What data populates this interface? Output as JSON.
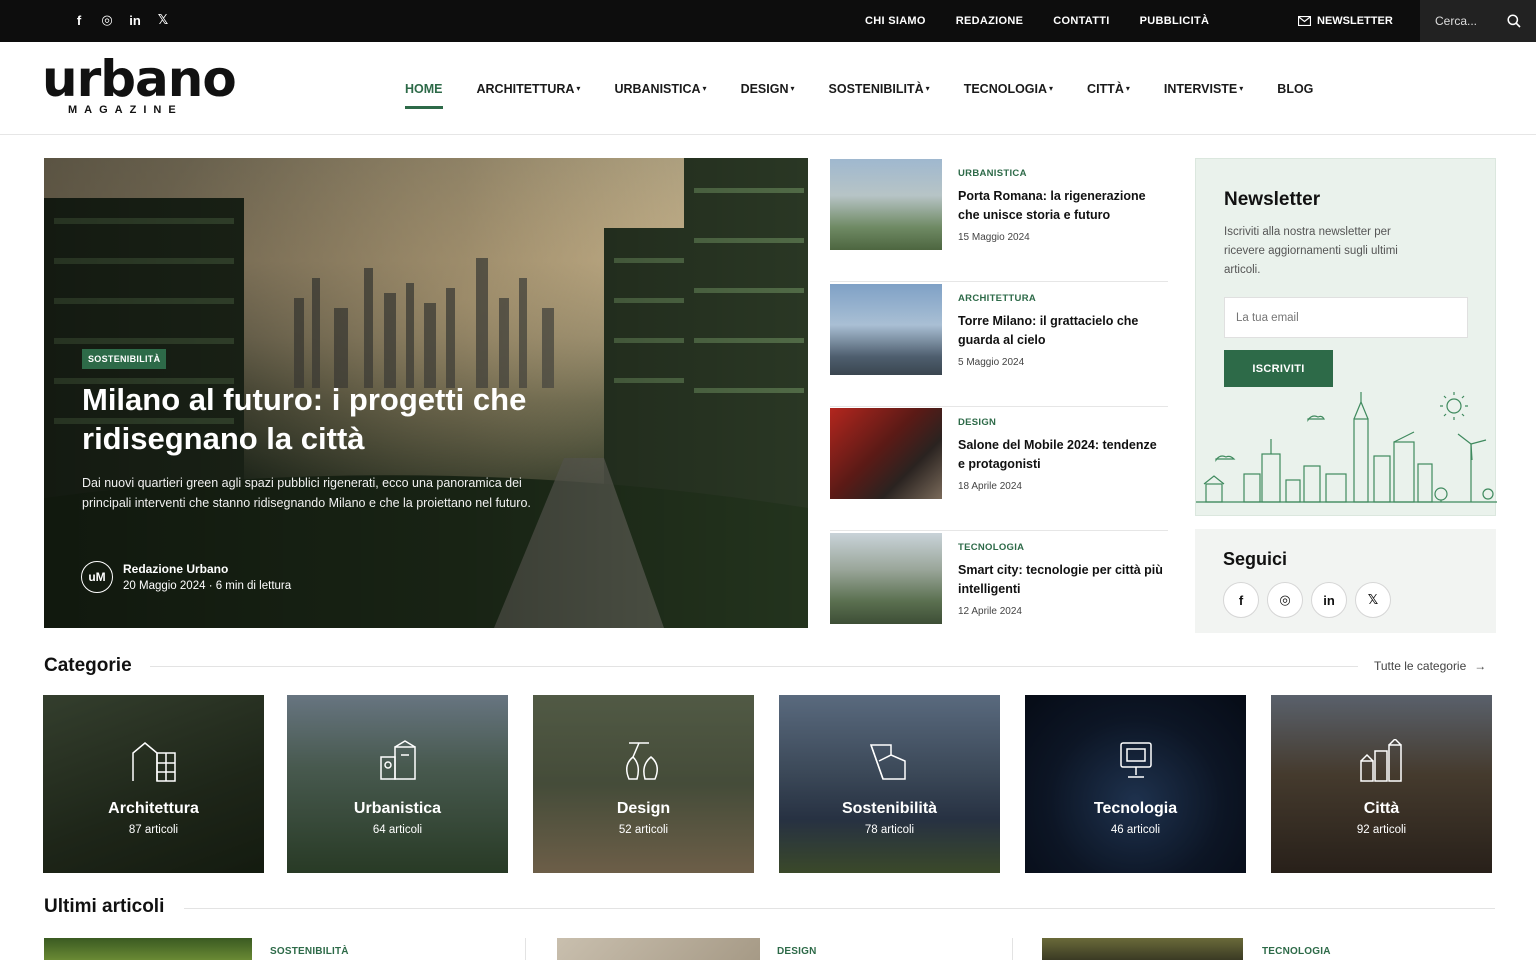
{
  "topbar": {
    "socials": [
      {
        "icon": "facebook-icon",
        "glyph": "f"
      },
      {
        "icon": "instagram-icon",
        "glyph": "◎"
      },
      {
        "icon": "linkedin-icon",
        "glyph": "in"
      },
      {
        "icon": "x-icon",
        "glyph": "𝕏"
      }
    ],
    "links": [
      "CHI SIAMO",
      "REDAZIONE",
      "CONTATTI",
      "PUBBLICITÀ"
    ],
    "newsletter": "NEWSLETTER",
    "search_placeholder": "Cerca..."
  },
  "header": {
    "logo_word": "urbano",
    "logo_sub": "MAGAZINE",
    "nav": [
      {
        "label": "HOME",
        "active": true,
        "dropdown": false
      },
      {
        "label": "ARCHITETTURA",
        "active": false,
        "dropdown": true
      },
      {
        "label": "URBANISTICA",
        "active": false,
        "dropdown": true
      },
      {
        "label": "DESIGN",
        "active": false,
        "dropdown": true
      },
      {
        "label": "SOSTENIBILITÀ",
        "active": false,
        "dropdown": true
      },
      {
        "label": "TECNOLOGIA",
        "active": false,
        "dropdown": true
      },
      {
        "label": "CITTÀ",
        "active": false,
        "dropdown": true
      },
      {
        "label": "INTERVISTE",
        "active": false,
        "dropdown": true
      },
      {
        "label": "BLOG",
        "active": false,
        "dropdown": false
      }
    ]
  },
  "hero": {
    "badge": "SOSTENIBILITÀ",
    "title": "Milano al futuro: i progetti che ridisegnano la città",
    "excerpt": "Dai nuovi quartieri green agli spazi pubblici rigenerati, ecco una panoramica dei principali interventi che stanno ridisegnando Milano e che la proiettano nel futuro.",
    "avatar": "uM",
    "author": "Redazione Urbano",
    "date": "20 Maggio 2024",
    "read_time": "6 min di lettura"
  },
  "side_articles": [
    {
      "category": "URBANISTICA",
      "title": "Porta Romana: la rigenerazione che unisce storia e futuro",
      "date": "15 Maggio 2024",
      "thumb": "#7f9a8a"
    },
    {
      "category": "ARCHITETTURA",
      "title": "Torre Milano: il grattacielo che guarda al cielo",
      "date": "5 Maggio 2024",
      "thumb": "#6f8aa8"
    },
    {
      "category": "DESIGN",
      "title": "Salone del Mobile 2024: tendenze e protagonisti",
      "date": "18 Aprile 2024",
      "thumb": "#8a2a24"
    },
    {
      "category": "TECNOLOGIA",
      "title": "Smart city: tecnologie per città più intelligenti",
      "date": "12 Aprile 2024",
      "thumb": "#7d927c"
    }
  ],
  "newsletter": {
    "title": "Newsletter",
    "text": "Iscriviti alla nostra newsletter per ricevere aggiornamenti sugli ultimi articoli.",
    "placeholder": "La tua email",
    "button": "ISCRIVITI"
  },
  "follow": {
    "title": "Seguici",
    "icons": [
      {
        "icon": "facebook-icon",
        "glyph": "f"
      },
      {
        "icon": "instagram-icon",
        "glyph": "◎"
      },
      {
        "icon": "linkedin-icon",
        "glyph": "in"
      },
      {
        "icon": "x-icon",
        "glyph": "𝕏"
      }
    ]
  },
  "categories": {
    "title": "Categorie",
    "all_link": "Tutte le categorie",
    "items": [
      {
        "name": "Architettura",
        "count": "87 articoli",
        "bg": "#3d4a34"
      },
      {
        "name": "Urbanistica",
        "count": "64 articoli",
        "bg": "#4f6a62"
      },
      {
        "name": "Design",
        "count": "52 articoli",
        "bg": "#7e8a6a"
      },
      {
        "name": "Sostenibilità",
        "count": "78 articoli",
        "bg": "#4a5a6e"
      },
      {
        "name": "Tecnologia",
        "count": "46 articoli",
        "bg": "#15253e"
      },
      {
        "name": "Città",
        "count": "92 articoli",
        "bg": "#5a4a3a"
      }
    ]
  },
  "latest": {
    "title": "Ultimi articoli",
    "items": [
      {
        "category": "SOSTENIBILITÀ",
        "thumb": "#4e6a2e"
      },
      {
        "category": "DESIGN",
        "thumb": "#b8ad98"
      },
      {
        "category": "TECNOLOGIA",
        "thumb": "#5a5a3a"
      }
    ]
  },
  "colors": {
    "accent": "#2d6a48",
    "topbar": "#0d0d0d",
    "newsletter_bg": "#eaf2ec"
  }
}
